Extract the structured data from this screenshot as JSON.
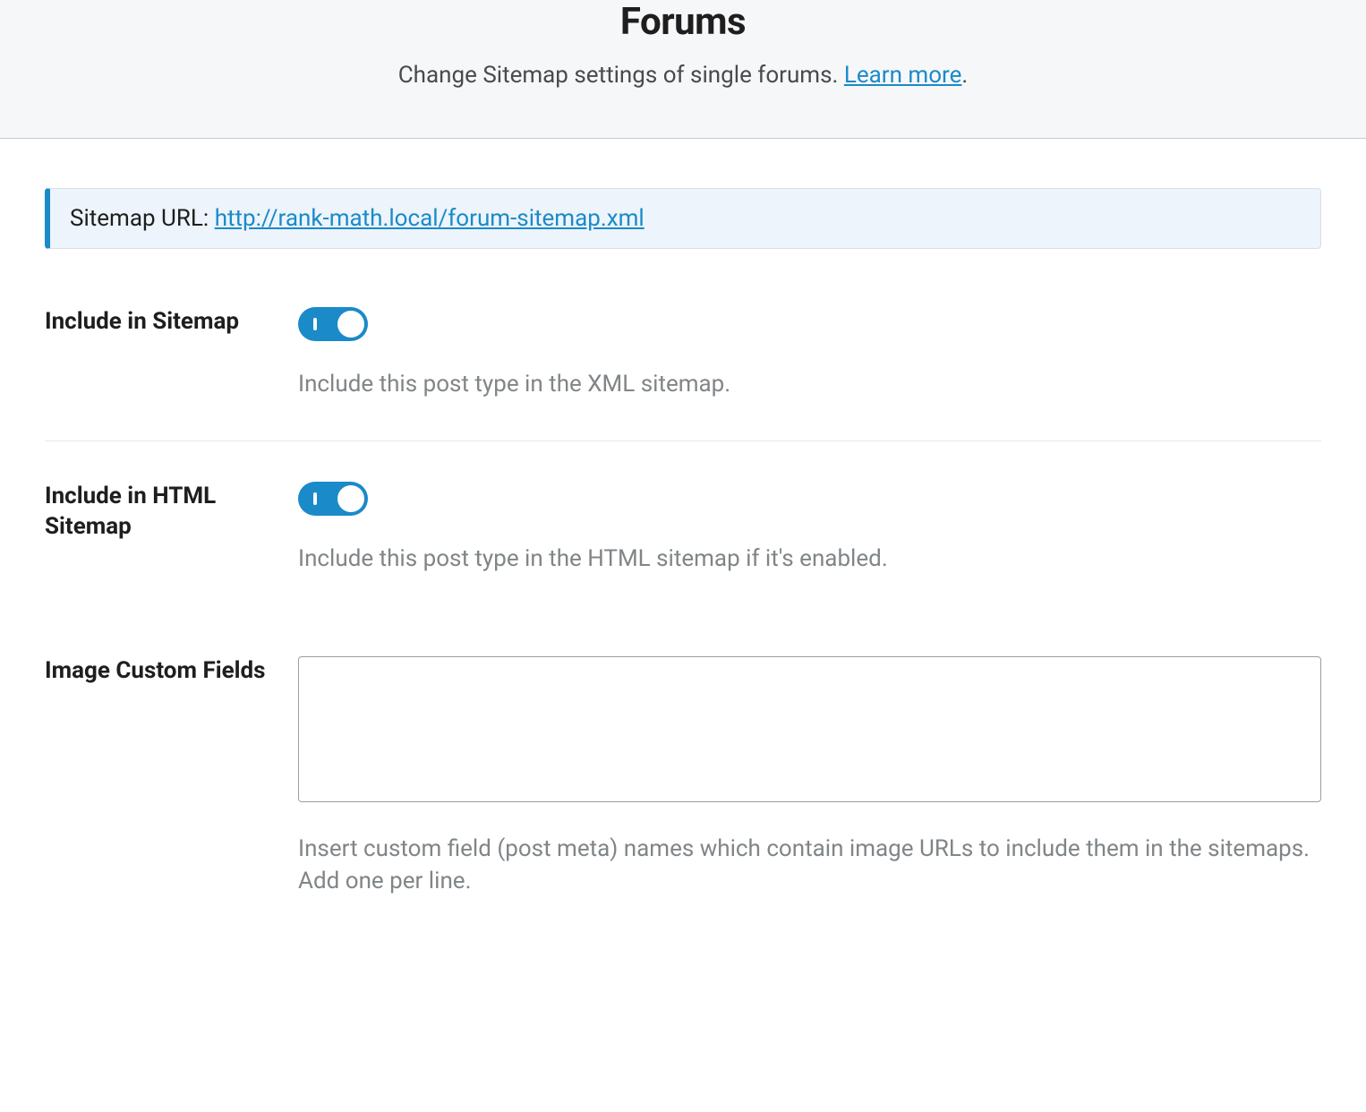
{
  "header": {
    "title": "Forums",
    "subtitle_prefix": "Change Sitemap settings of single forums. ",
    "learn_more_label": "Learn more",
    "subtitle_suffix": "."
  },
  "notice": {
    "label": "Sitemap URL: ",
    "url": "http://rank-math.local/forum-sitemap.xml"
  },
  "fields": {
    "include_sitemap": {
      "label": "Include in Sitemap",
      "value": true,
      "description": "Include this post type in the XML sitemap."
    },
    "include_html_sitemap": {
      "label": "Include in HTML Sitemap",
      "value": true,
      "description": "Include this post type in the HTML sitemap if it's enabled."
    },
    "image_custom_fields": {
      "label": "Image Custom Fields",
      "value": "",
      "description": "Insert custom field (post meta) names which contain image URLs to include them in the sitemaps. Add one per line."
    }
  }
}
